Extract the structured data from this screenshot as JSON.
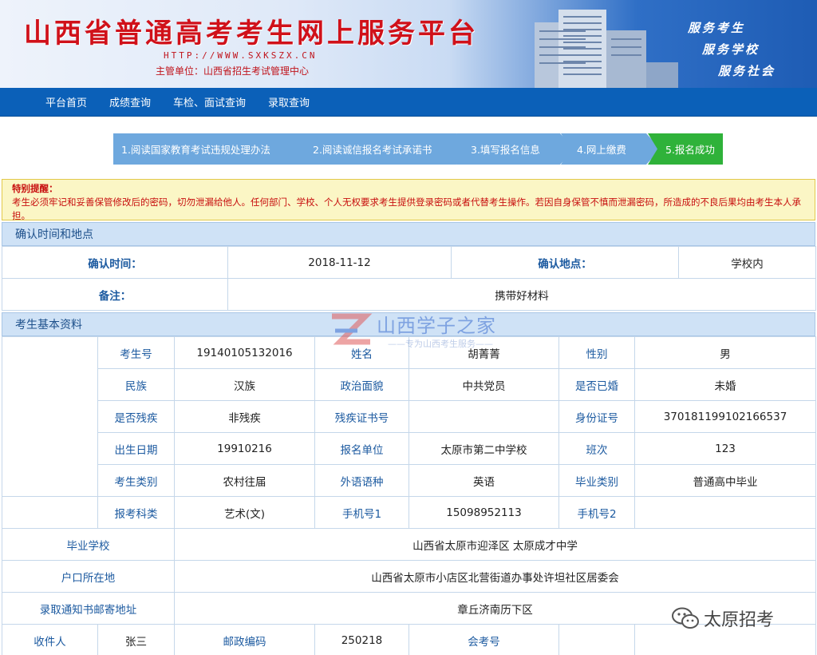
{
  "header": {
    "title": "山西省普通高考考生网上服务平台",
    "url": "HTTP://WWW.SXKSZX.CN",
    "host": "主管单位：山西省招生考试管理中心",
    "mottos": [
      "服务考生",
      "服务学校",
      "服务社会"
    ]
  },
  "nav": {
    "items": [
      "平台首页",
      "成绩查询",
      "车检、面试查询",
      "录取查询"
    ]
  },
  "steps": [
    "1.阅读国家教育考试违规处理办法",
    "2.阅读诚信报名考试承诺书",
    "3.填写报名信息",
    "4.网上缴费",
    "5.报名成功"
  ],
  "notice": {
    "heading": "特别提醒：",
    "body": "考生必须牢记和妥善保管修改后的密码，切勿泄漏给他人。任何部门、学校、个人无权要求考生提供登录密码或者代替考生操作。若因自身保管不慎而泄漏密码，所造成的不良后果均由考生本人承担。"
  },
  "confirm": {
    "section_title": "确认时间和地点",
    "time_label": "确认时间：",
    "time_value": "2018-11-12",
    "place_label": "确认地点：",
    "place_value": "学校内",
    "note_label": "备注：",
    "note_value": "携带好材料"
  },
  "basic": {
    "section_title": "考生基本资料",
    "exam_no_label": "考生号",
    "exam_no": "19140105132016",
    "name_label": "姓名",
    "name": "胡菁菁",
    "gender_label": "性别",
    "gender": "男",
    "ethnic_label": "民族",
    "ethnic": "汉族",
    "political_label": "政治面貌",
    "political": "中共党员",
    "married_label": "是否已婚",
    "married": "未婚",
    "disabled_label": "是否残疾",
    "disabled": "非残疾",
    "disabled_cert_label": "残疾证书号",
    "disabled_cert": "",
    "id_label": "身份证号",
    "id": "370181199102166537",
    "birth_label": "出生日期",
    "birth": "19910216",
    "unit_label": "报名单位",
    "unit": "太原市第二中学校",
    "class_label": "班次",
    "class": "123",
    "category_label": "考生类别",
    "category": "农村往届",
    "language_label": "外语语种",
    "language": "英语",
    "grad_type_label": "毕业类别",
    "grad_type": "普通高中毕业",
    "subject_label": "报考科类",
    "subject": "艺术(文)",
    "phone1_label": "手机号1",
    "phone1": "15098952113",
    "phone2_label": "手机号2",
    "phone2": "",
    "school_label": "毕业学校",
    "school": "山西省太原市迎泽区 太原成才中学",
    "hukou_label": "户口所在地",
    "hukou": "山西省太原市小店区北营街道办事处许坦社区居委会",
    "mail_addr_label": "录取通知书邮寄地址",
    "mail_addr": "章丘济南历下区",
    "recipient_label": "收件人",
    "recipient": "张三",
    "postcode_label": "邮政编码",
    "postcode": "250218",
    "huikao_label": "会考号",
    "huikao": ""
  },
  "watermark": {
    "text": "山西学子之家",
    "sub": "——专为山西考生服务——"
  },
  "wechat": {
    "name": "太原招考"
  },
  "colors": {
    "nav_bg": "#0b60b8",
    "step_pending": "#6ea8de",
    "step_done": "#2fb23a",
    "title_red": "#d0111a",
    "notice_bg": "#fbf6c5"
  }
}
